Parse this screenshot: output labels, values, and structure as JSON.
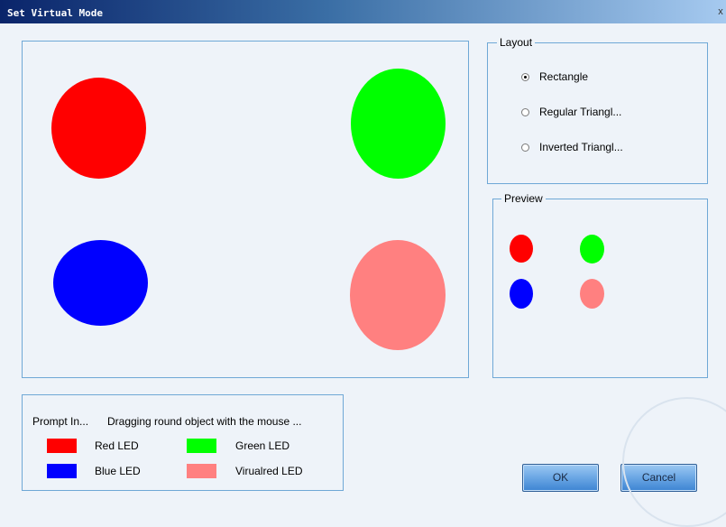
{
  "window": {
    "title": "Set Virtual Mode",
    "close_glyph": "x"
  },
  "canvas": {
    "leds": [
      {
        "name": "red-led",
        "color": "#ff0000"
      },
      {
        "name": "green-led",
        "color": "#00ff00"
      },
      {
        "name": "blue-led",
        "color": "#0000ff"
      },
      {
        "name": "virtual-red-led",
        "color": "#ff8080"
      }
    ]
  },
  "layout": {
    "legend": "Layout",
    "options": [
      {
        "label": "Rectangle",
        "checked": true
      },
      {
        "label": "Regular Triangl...",
        "checked": false
      },
      {
        "label": "Inverted Triangl...",
        "checked": false
      }
    ]
  },
  "preview": {
    "legend": "Preview"
  },
  "prompt": {
    "title": "Prompt In...",
    "message": "Dragging round object with the mouse ...",
    "items": [
      {
        "label": "Red LED",
        "color": "#ff0000"
      },
      {
        "label": "Green LED",
        "color": "#00ff00"
      },
      {
        "label": "Blue LED",
        "color": "#0000ff"
      },
      {
        "label": "Virualred LED",
        "color": "#ff8080"
      }
    ]
  },
  "buttons": {
    "ok": "OK",
    "cancel": "Cancel"
  }
}
